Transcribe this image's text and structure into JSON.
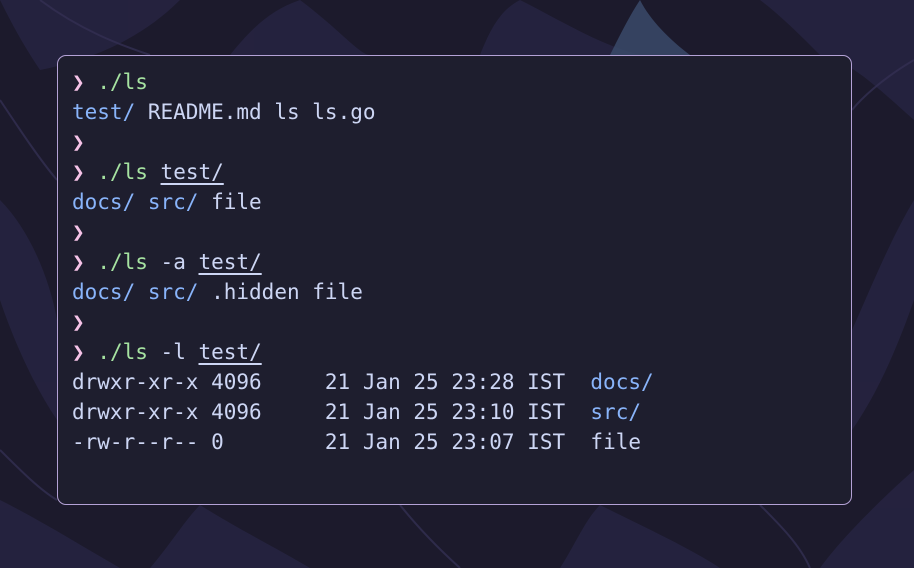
{
  "terminal": {
    "prompt_symbol": "❯",
    "lines": [
      {
        "type": "prompt",
        "command": "./ls",
        "args": ""
      },
      {
        "type": "output",
        "entries": [
          {
            "text": "test/",
            "kind": "dir"
          },
          {
            "text": "README.md",
            "kind": "file"
          },
          {
            "text": "ls",
            "kind": "file"
          },
          {
            "text": "ls.go",
            "kind": "file"
          }
        ]
      },
      {
        "type": "prompt",
        "command": "",
        "args": ""
      },
      {
        "type": "prompt",
        "command": "./ls",
        "flag": "",
        "path": "test/"
      },
      {
        "type": "output",
        "entries": [
          {
            "text": "docs/",
            "kind": "dir"
          },
          {
            "text": "src/",
            "kind": "dir"
          },
          {
            "text": "file",
            "kind": "file"
          }
        ]
      },
      {
        "type": "prompt",
        "command": "",
        "args": ""
      },
      {
        "type": "prompt",
        "command": "./ls",
        "flag": "-a",
        "path": "test/"
      },
      {
        "type": "output",
        "entries": [
          {
            "text": "docs/",
            "kind": "dir"
          },
          {
            "text": "src/",
            "kind": "dir"
          },
          {
            "text": ".hidden",
            "kind": "file"
          },
          {
            "text": "file",
            "kind": "file"
          }
        ]
      },
      {
        "type": "prompt",
        "command": "",
        "args": ""
      },
      {
        "type": "prompt",
        "command": "./ls",
        "flag": "-l",
        "path": "test/"
      },
      {
        "type": "long",
        "perm": "drwxr-xr-x",
        "size": "4096",
        "date": "21 Jan 25 23:28 IST",
        "name": "docs/",
        "kind": "dir"
      },
      {
        "type": "long",
        "perm": "drwxr-xr-x",
        "size": "4096",
        "date": "21 Jan 25 23:10 IST",
        "name": "src/",
        "kind": "dir"
      },
      {
        "type": "long",
        "perm": "-rw-r--r--",
        "size": "0",
        "date": "21 Jan 25 23:07 IST",
        "name": "file",
        "kind": "file"
      }
    ]
  },
  "colors": {
    "background": "#1e1e2e",
    "border": "#b4a2d6",
    "prompt": "#f5c2e7",
    "command": "#a6e3a1",
    "directory": "#89b4fa",
    "text": "#cdd6f4"
  }
}
